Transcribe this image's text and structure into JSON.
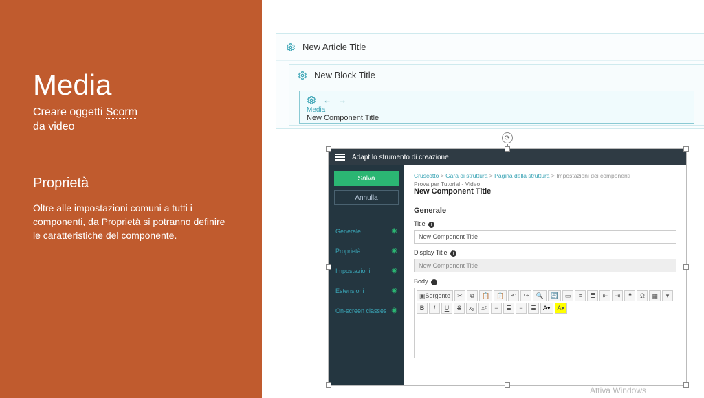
{
  "left": {
    "title": "Media",
    "subtitle_pre": "Creare oggetti ",
    "subtitle_under": "Scorm",
    "subtitle_post": "da video",
    "section": "Proprietà",
    "body": "Oltre alle impostazioni comuni a tutti i componenti, da Proprietà si potranno definire le caratteristiche del componente."
  },
  "outer": {
    "article_title": "New Article Title",
    "block_title": "New Block Title",
    "component_type": "Media",
    "component_title": "New Component Title"
  },
  "inset": {
    "topbar": "Adapt lo strumento di creazione",
    "save": "Salva",
    "cancel": "Annulla",
    "nav": [
      "Generale",
      "Proprietà",
      "Impostazioni",
      "Estensioni",
      "On-screen classes"
    ],
    "crumbs": [
      "Cruscotto",
      "Gara di struttura",
      "Pagina della struttura",
      "Impostazioni dei componenti"
    ],
    "pretitle": "Prova per Tutorial - Video",
    "maintitle": "New Component Title",
    "section": "Generale",
    "field_title": "Title",
    "field_title_val": "New Component Title",
    "field_display": "Display Title",
    "field_display_val": "New Component Title",
    "field_body": "Body",
    "toolbar_source": "Sorgente"
  },
  "watermark": "Attiva Windows"
}
